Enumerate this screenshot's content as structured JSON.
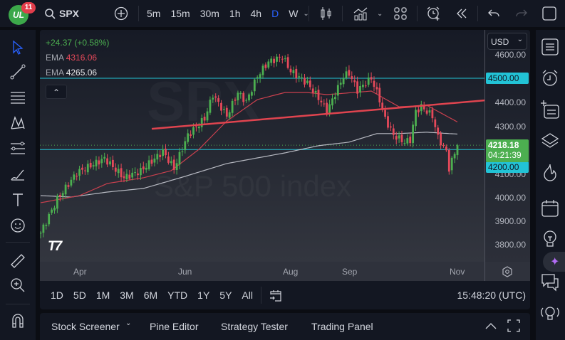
{
  "app": {
    "notifications": "11",
    "symbol": "SPX"
  },
  "toolbar": {
    "timeframes": [
      "5m",
      "15m",
      "30m",
      "1h",
      "4h",
      "D",
      "W"
    ],
    "active_timeframe": "D"
  },
  "legend": {
    "change": "+24.37 (+0.58%)",
    "ema1_label": "EMA",
    "ema1_value": "4316.06",
    "ema2_label": "EMA",
    "ema2_value": "4265.06"
  },
  "watermark": {
    "symbol": "SPX",
    "name": "S&P 500 index"
  },
  "price_axis": {
    "currency": "USD",
    "labels": [
      "4600.00",
      "4400.00",
      "4300.00",
      "4100.00",
      "4000.00",
      "3900.00",
      "3800.00"
    ],
    "level_4500": "4500.00",
    "level_4200": "4200.00",
    "last_price": "4218.18",
    "countdown": "04:21:39"
  },
  "time_axis": {
    "labels": [
      "Apr",
      "Jun",
      "Aug",
      "Sep",
      "Nov"
    ]
  },
  "range_bar": {
    "ranges": [
      "1D",
      "5D",
      "1M",
      "3M",
      "6M",
      "YTD",
      "1Y",
      "5Y",
      "All"
    ],
    "clock": "15:48:20 (UTC)"
  },
  "bottom_panel": {
    "tabs": [
      "Stock Screener",
      "Pine Editor",
      "Strategy Tester",
      "Trading Panel"
    ]
  },
  "colors": {
    "up": "#4caf50",
    "down": "#e5495a",
    "ema50": "#c9404e",
    "ema200": "#d1d4dc",
    "level": "#22c3d6",
    "trend": "#e0444f",
    "accent": "#2962ff"
  },
  "chart_data": {
    "type": "candlestick",
    "symbol": "SPX",
    "ylim": [
      3750,
      4640
    ],
    "close_path": [
      [
        0,
        3850
      ],
      [
        6,
        3991
      ],
      [
        13,
        4102
      ],
      [
        23,
        4162
      ],
      [
        30,
        4081
      ],
      [
        36,
        4110
      ],
      [
        44,
        4192
      ],
      [
        48,
        4120
      ],
      [
        53,
        4260
      ],
      [
        59,
        4330
      ],
      [
        62,
        4431
      ],
      [
        67,
        4341
      ],
      [
        71,
        4440
      ],
      [
        74,
        4401
      ],
      [
        78,
        4509
      ],
      [
        82,
        4569
      ],
      [
        87,
        4590
      ],
      [
        90,
        4530
      ],
      [
        96,
        4479
      ],
      [
        101,
        4401
      ],
      [
        103,
        4360
      ],
      [
        109,
        4509
      ],
      [
        111,
        4521
      ],
      [
        114,
        4449
      ],
      [
        119,
        4500
      ],
      [
        122,
        4410
      ],
      [
        124,
        4329
      ],
      [
        127,
        4260
      ],
      [
        131,
        4231
      ],
      [
        133,
        4240
      ],
      [
        135,
        4360
      ],
      [
        137,
        4380
      ],
      [
        141,
        4341
      ],
      [
        143,
        4251
      ],
      [
        146,
        4192
      ],
      [
        147,
        4120
      ],
      [
        150,
        4218
      ]
    ],
    "ema_50": [
      [
        0,
        3976
      ],
      [
        14,
        4006
      ],
      [
        24,
        4057
      ],
      [
        37,
        4081
      ],
      [
        47,
        4111
      ],
      [
        57,
        4201
      ],
      [
        67,
        4320
      ],
      [
        78,
        4410
      ],
      [
        88,
        4440
      ],
      [
        96,
        4440
      ],
      [
        103,
        4431
      ],
      [
        119,
        4446
      ],
      [
        129,
        4380
      ],
      [
        139,
        4386
      ],
      [
        150,
        4316
      ]
    ],
    "ema_200": [
      [
        0,
        4006
      ],
      [
        11,
        4000
      ],
      [
        24,
        4021
      ],
      [
        37,
        4036
      ],
      [
        52,
        4087
      ],
      [
        67,
        4141
      ],
      [
        88,
        4186
      ],
      [
        100,
        4216
      ],
      [
        111,
        4231
      ],
      [
        121,
        4267
      ],
      [
        129,
        4267
      ],
      [
        139,
        4273
      ],
      [
        150,
        4265
      ]
    ],
    "horizontal_levels": [
      4500,
      4200
    ],
    "trendline": [
      [
        40,
        4287
      ],
      [
        160,
        4407
      ]
    ],
    "last_price": 4218.18
  }
}
